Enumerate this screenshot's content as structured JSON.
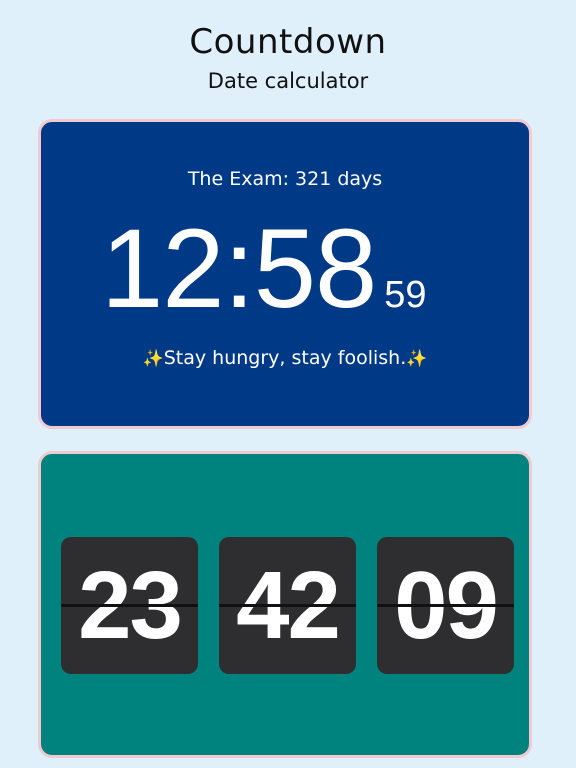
{
  "header": {
    "title": "Countdown",
    "subtitle": "Date calculator"
  },
  "event_card": {
    "event_text": "The Exam: 321 days",
    "time_main": "12:58",
    "time_seconds": "59",
    "quote_sparkle_left": "✨",
    "quote": "Stay hungry, stay foolish.",
    "quote_sparkle_right": "✨",
    "background_color": "#003a86"
  },
  "flip_clock": {
    "hours": "23",
    "minutes": "42",
    "seconds": "09",
    "background_color": "#00827f",
    "tile_color": "#2e2d30"
  }
}
